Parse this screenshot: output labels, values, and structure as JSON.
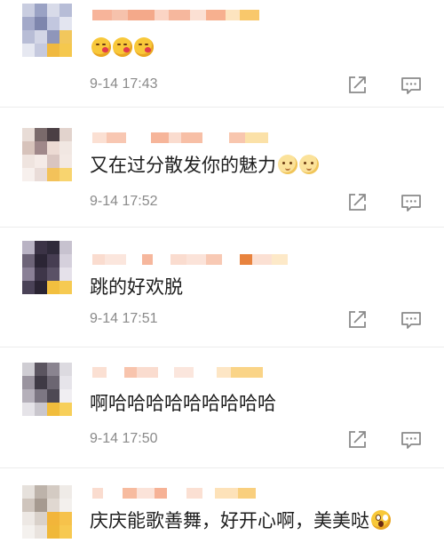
{
  "comments": [
    {
      "text": "",
      "emojis": [
        "kiss-emoji",
        "kiss-emoji",
        "kiss-emoji"
      ],
      "timestamp": "9-14 17:43"
    },
    {
      "text": "又在过分散发你的魅力",
      "emojis": [
        "shy-emoji",
        "shy-emoji"
      ],
      "timestamp": "9-14 17:52"
    },
    {
      "text": "跳的好欢脱",
      "emojis": [],
      "timestamp": "9-14 17:51"
    },
    {
      "text": "啊哈哈哈哈哈哈哈哈哈",
      "emojis": [],
      "timestamp": "9-14 17:50"
    },
    {
      "text": "庆庆能歌善舞，好开心啊，美美哒",
      "emojis": [
        "shock-emoji"
      ],
      "timestamp": ""
    }
  ],
  "colors": {
    "timestamp": "#8a8a8a",
    "icon": "#8a8a8a",
    "text": "#1e1e1e",
    "divider": "#ececec"
  },
  "icons": {
    "share": "share-icon",
    "reply": "comment-icon"
  }
}
